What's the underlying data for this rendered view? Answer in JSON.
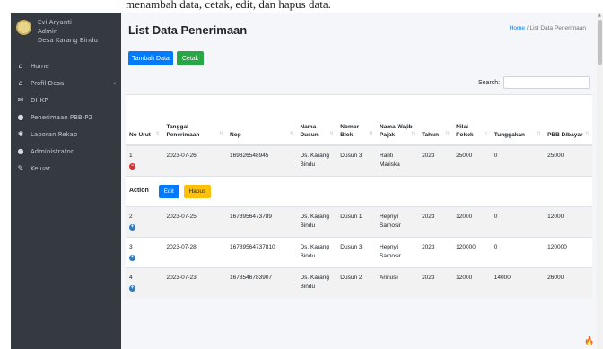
{
  "caption_text": "menambah data, cetak, edit, dan hapus data.",
  "user": {
    "name": "Evi Aryanti",
    "role": "Admin",
    "village": "Desa Karang Bindu"
  },
  "sidebar": {
    "items": [
      {
        "label": "Home",
        "icon": "home-icon",
        "glyph": "⌂"
      },
      {
        "label": "Profil Desa",
        "icon": "home-icon",
        "glyph": "⌂",
        "chevron": "‹"
      },
      {
        "label": "DHKP",
        "icon": "mail-icon",
        "glyph": "✉"
      },
      {
        "label": "Penerimaan PBB-P2",
        "icon": "user-icon",
        "glyph": "●"
      },
      {
        "label": "Laporan Rekap",
        "icon": "palette-icon",
        "glyph": "✱"
      },
      {
        "label": "Administrator",
        "icon": "user-icon",
        "glyph": "●"
      },
      {
        "label": "Keluar",
        "icon": "wrench-icon",
        "glyph": "✎"
      }
    ]
  },
  "header": {
    "title": "List Data Penerimaan",
    "breadcrumb_home": "Home",
    "breadcrumb_sep": "/",
    "breadcrumb_current": "List Data Penerimaan"
  },
  "toolbar": {
    "add_label": "Tambah Data",
    "print_label": "Cetak"
  },
  "search": {
    "label": "Search:",
    "value": ""
  },
  "table": {
    "headers": [
      "No Urut",
      "Tanggal Penerimaan",
      "Nop",
      "Nama Dusun",
      "Nomor Blok",
      "Nama Wajib Pajak",
      "Tahun",
      "Nilai Pokok",
      "Tunggakan",
      "PBB Dibayar"
    ],
    "rows": [
      {
        "no": "1",
        "tanggal": "2023-07-26",
        "nop": "169826548945",
        "dusun": "Ds. Karang Bindu",
        "blok": "Dusun 3",
        "wp": "Ranti Mariska",
        "tahun": "2023",
        "pokok": "25000",
        "tunggakan": "0",
        "dibayar": "25000"
      },
      {
        "no": "2",
        "tanggal": "2023-07-25",
        "nop": "1678956473789",
        "dusun": "Ds. Karang Bindu",
        "blok": "Dusun 1",
        "wp": "Hepnyi Samosir",
        "tahun": "2023",
        "pokok": "12000",
        "tunggakan": "0",
        "dibayar": "12000"
      },
      {
        "no": "3",
        "tanggal": "2023-07-28",
        "nop": "16789564737810",
        "dusun": "Ds. Karang Bindu",
        "blok": "Dusun 3",
        "wp": "Hepnyi Samosir",
        "tahun": "2023",
        "pokok": "120000",
        "tunggakan": "0",
        "dibayar": "120000"
      },
      {
        "no": "4",
        "tanggal": "2023-07-23",
        "nop": "1678546783907",
        "dusun": "Ds. Karang Bindu",
        "blok": "Dusun 2",
        "wp": "Arinusi",
        "tahun": "2023",
        "pokok": "12000",
        "tunggakan": "14000",
        "dibayar": "26000"
      }
    ],
    "child_row": {
      "action_label": "Action",
      "edit_label": "Edit",
      "hapus_label": "Hapus"
    }
  },
  "colors": {
    "sidebar_bg": "#343a40",
    "primary": "#007bff",
    "success": "#28a745",
    "warning": "#ffc107",
    "danger": "#d33333"
  }
}
